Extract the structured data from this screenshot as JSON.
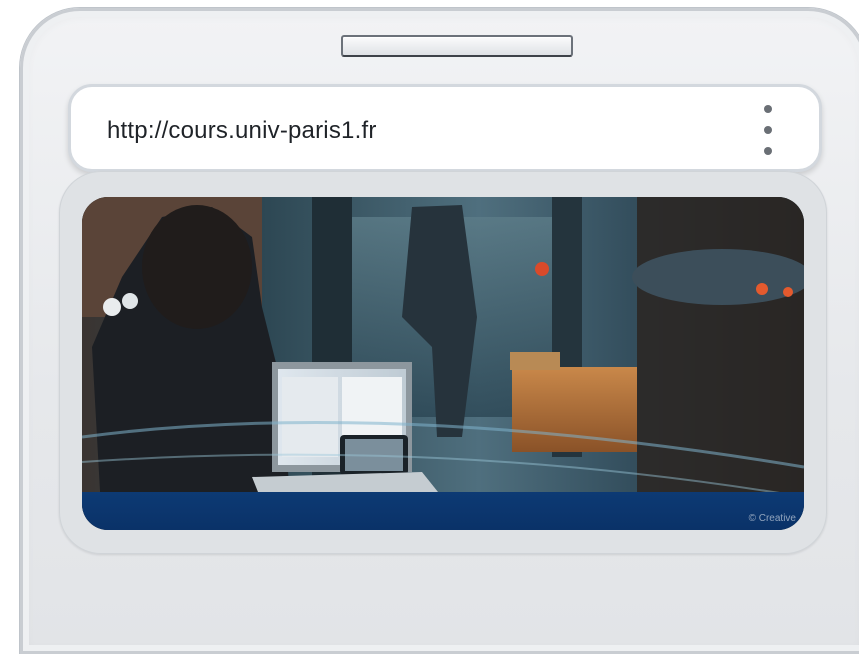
{
  "browser": {
    "url": "http://cours.univ-paris1.fr",
    "menu_icon": "kebab-menu-icon"
  },
  "photo": {
    "credit": "© Creative"
  },
  "colors": {
    "device_frame": "#e6e8eb",
    "banner_blue": "#0d3a74"
  }
}
